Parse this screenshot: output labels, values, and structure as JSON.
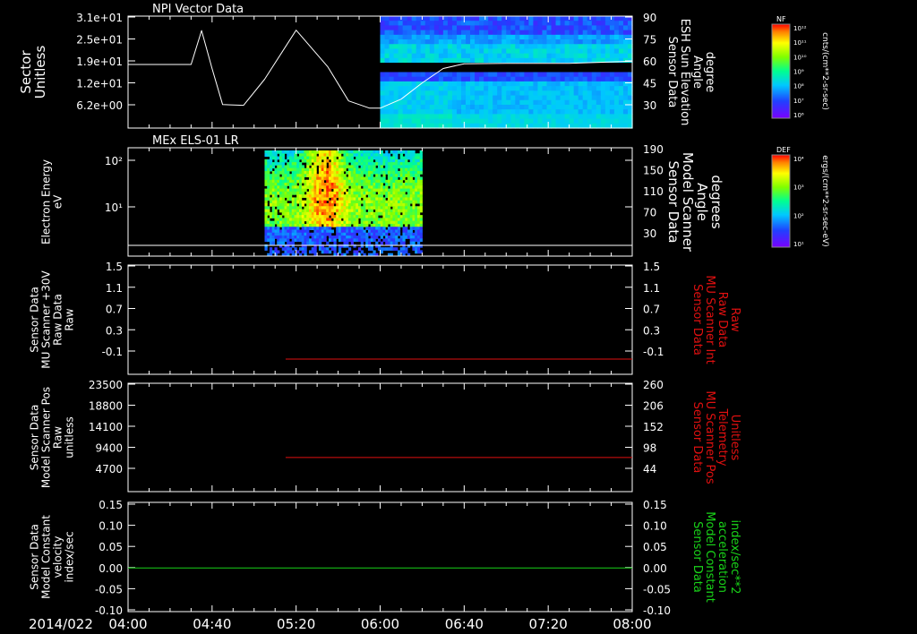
{
  "date_label": "2014/022",
  "x_ticks": [
    "04:00",
    "04:40",
    "05:20",
    "06:00",
    "06:40",
    "07:20",
    "08:00"
  ],
  "colors": {
    "white": "#ffffff",
    "red": "#e01010",
    "green": "#19d319"
  },
  "chart_data": [
    {
      "type": "line",
      "title": "NPI Vector Data",
      "ylabel": [
        "Sector",
        "Unitless"
      ],
      "yticks": [
        "3.1e+01",
        "2.5e+01",
        "1.9e+01",
        "1.2e+01",
        "6.2e+00"
      ],
      "ylim": [
        0,
        31
      ],
      "right_ylabel": [
        "Sensor Data",
        "ESH Sun Elevation",
        "Angle",
        "degree"
      ],
      "right_yticks": [
        "90",
        "75",
        "60",
        "45",
        "30"
      ],
      "right_ylim": [
        15,
        90
      ],
      "series": [
        {
          "values_time": [
            "04:00",
            "04:30",
            "04:35",
            "04:40",
            "04:45",
            "04:55",
            "05:05",
            "05:20",
            "05:35",
            "05:45",
            "05:55",
            "06:00"
          ],
          "values": [
            18.1,
            18.1,
            27.5,
            17.0,
            7.0,
            6.8,
            14.0,
            27.6,
            17.5,
            8.0,
            6.0,
            6.0
          ]
        },
        {
          "values_time": [
            "06:00",
            "06:10",
            "06:20",
            "06:30",
            "06:40",
            "07:00",
            "07:30",
            "08:00"
          ],
          "values": [
            6.0,
            8.5,
            13.0,
            17.0,
            18.3,
            18.4,
            18.4,
            19.0
          ]
        }
      ],
      "spectrogram": {
        "time_range": [
          "06:00",
          "08:00"
        ]
      },
      "colorbar": {
        "label": "NF",
        "units": "cnts/(cm**2-sr-sec)",
        "ticks": [
          "10¹²",
          "10¹¹",
          "10¹⁰",
          "10⁹",
          "10⁸",
          "10⁷",
          "10⁶"
        ]
      }
    },
    {
      "type": "heatmap",
      "title": "MEx ELS-01 LR",
      "ylabel": [
        "Electron Energy",
        "eV"
      ],
      "yticks": [
        "10²",
        "10¹"
      ],
      "right_ylabel": [
        "Sensor Data",
        "Model Scanner",
        "Angle",
        "degrees"
      ],
      "right_yticks": [
        "190",
        "150",
        "110",
        "70",
        "30"
      ],
      "right_ylim": [
        0,
        190
      ],
      "spectrogram": {
        "time_range": [
          "05:05",
          "06:20"
        ]
      },
      "line_value": 10,
      "colorbar": {
        "label": "DEF",
        "units": "ergs/(cm**2-sr-sec-eV)",
        "ticks": [
          "10⁴",
          "10³",
          "10²",
          "10¹"
        ]
      }
    },
    {
      "type": "line",
      "ylabel": [
        "Sensor Data",
        "MU Scanner +30V",
        "Raw Data",
        "Raw"
      ],
      "yticks": [
        "1.5",
        "1.1",
        "0.7",
        "0.3",
        "-0.1"
      ],
      "ylim": [
        -0.3,
        1.5
      ],
      "right_ylabel": [
        "Sensor Data",
        "MU Scanner Int",
        "Raw Data",
        "Raw"
      ],
      "right_yticks": [
        "1.5",
        "1.1",
        "0.7",
        "0.3",
        "-0.1"
      ],
      "series": [
        {
          "time_range": [
            "05:15",
            "08:00"
          ],
          "value": -0.05
        }
      ]
    },
    {
      "type": "line",
      "ylabel": [
        "Sensor Data",
        "Model Scanner Pos",
        "Raw",
        "unitless"
      ],
      "yticks": [
        "23500",
        "18800",
        "14100",
        "9400",
        "4700"
      ],
      "ylim": [
        0,
        23500
      ],
      "right_ylabel": [
        "Sensor Data",
        "MU Scanner Pos",
        "Telemetry",
        "Unitless"
      ],
      "right_yticks": [
        "260",
        "206",
        "152",
        "98",
        "44"
      ],
      "series": [
        {
          "time_range": [
            "05:15",
            "08:00"
          ],
          "value": 7400
        }
      ]
    },
    {
      "type": "line",
      "ylabel": [
        "Sensor Data",
        "Model Constant",
        "velocity",
        "index/sec"
      ],
      "yticks": [
        "0.15",
        "0.10",
        "0.05",
        "0.00",
        "-0.05",
        "-0.10"
      ],
      "ylim": [
        -0.1,
        0.15
      ],
      "right_ylabel": [
        "Sensor Data",
        "Model Constant",
        "acceleration",
        "index/sec**2"
      ],
      "right_yticks": [
        "0.15",
        "0.10",
        "0.05",
        "0.00",
        "-0.05",
        "-0.10"
      ],
      "series": [
        {
          "time_range": [
            "04:00",
            "08:00"
          ],
          "value": 0.0
        }
      ]
    }
  ]
}
